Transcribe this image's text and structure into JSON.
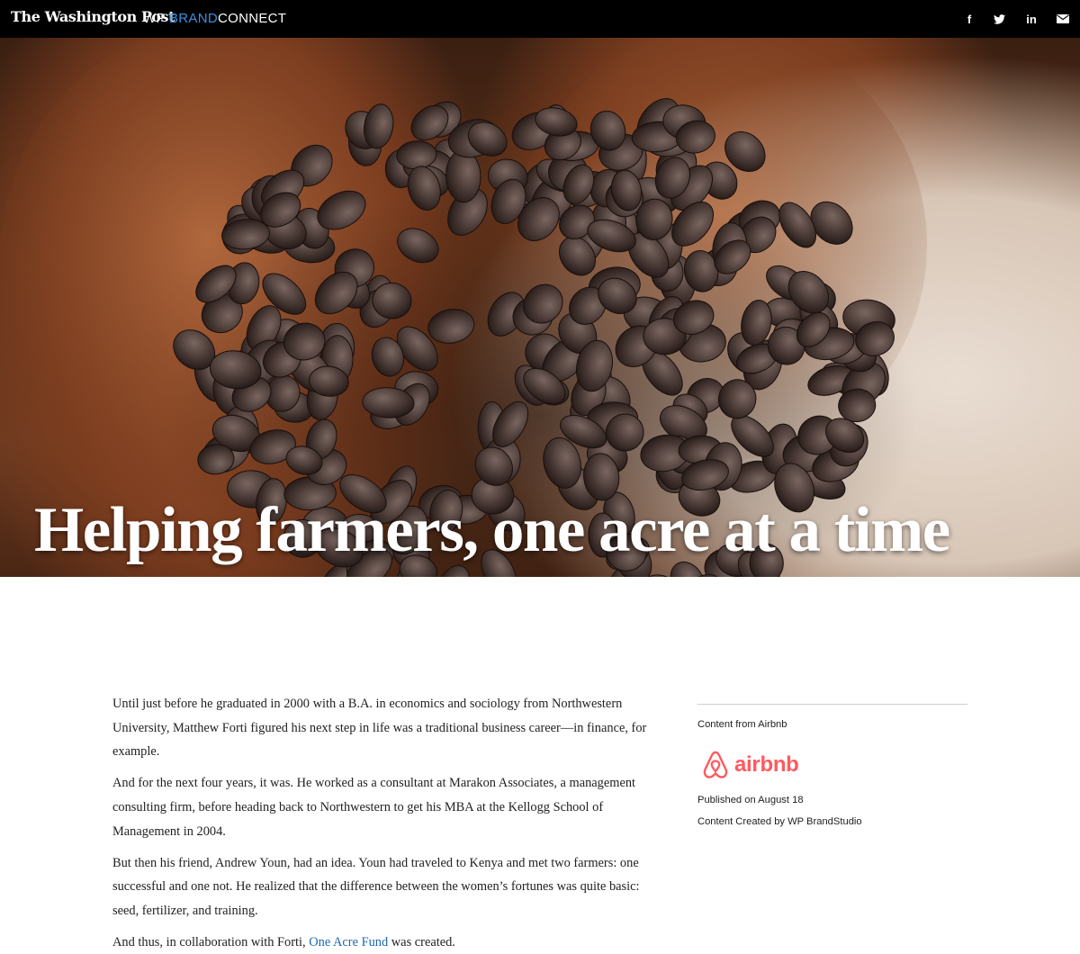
{
  "header": {
    "logo_text": "The Washington Post",
    "brand_wp": "WP",
    "brand_brand": "BRAND",
    "brand_connect": "CONNECT",
    "social": [
      {
        "name": "facebook",
        "glyph": "f"
      },
      {
        "name": "twitter",
        "icon": "twitter-icon"
      },
      {
        "name": "linkedin",
        "glyph": "in"
      },
      {
        "name": "email",
        "icon": "email-icon"
      }
    ]
  },
  "hero": {
    "title": "Helping farmers, one acre at a time"
  },
  "article": {
    "p1": "Until just before he graduated in 2000 with a B.A. in economics and sociology from Northwestern University, Matthew Forti figured his next step in life was a traditional business career—in finance, for example.",
    "p2": "And for the next four years, it was. He worked as a consultant at Marakon Associates, a management consulting firm, before heading back to Northwestern to get his MBA at the Kellogg School of Management in 2004.",
    "p3": "But then his friend, Andrew Youn, had an idea. Youn had traveled to Kenya and met two farmers: one successful and one not. He realized that the difference between the women’s fortunes was quite basic: seed, fertilizer, and training.",
    "p4_before": "And thus, in collaboration with Forti, ",
    "p4_link": "One Acre Fund",
    "p4_after": " was created."
  },
  "sidebar": {
    "content_from": "Content from Airbnb",
    "sponsor_logo_text": "airbnb",
    "published": "Published on August 18",
    "created_by": "Content Created by WP BrandStudio"
  },
  "colors": {
    "topbar": "#000000",
    "brand_accent": "#3d8fe0",
    "link": "#1f67b1",
    "airbnb": "#ff5a5f",
    "divider": "#cfcfcf"
  }
}
